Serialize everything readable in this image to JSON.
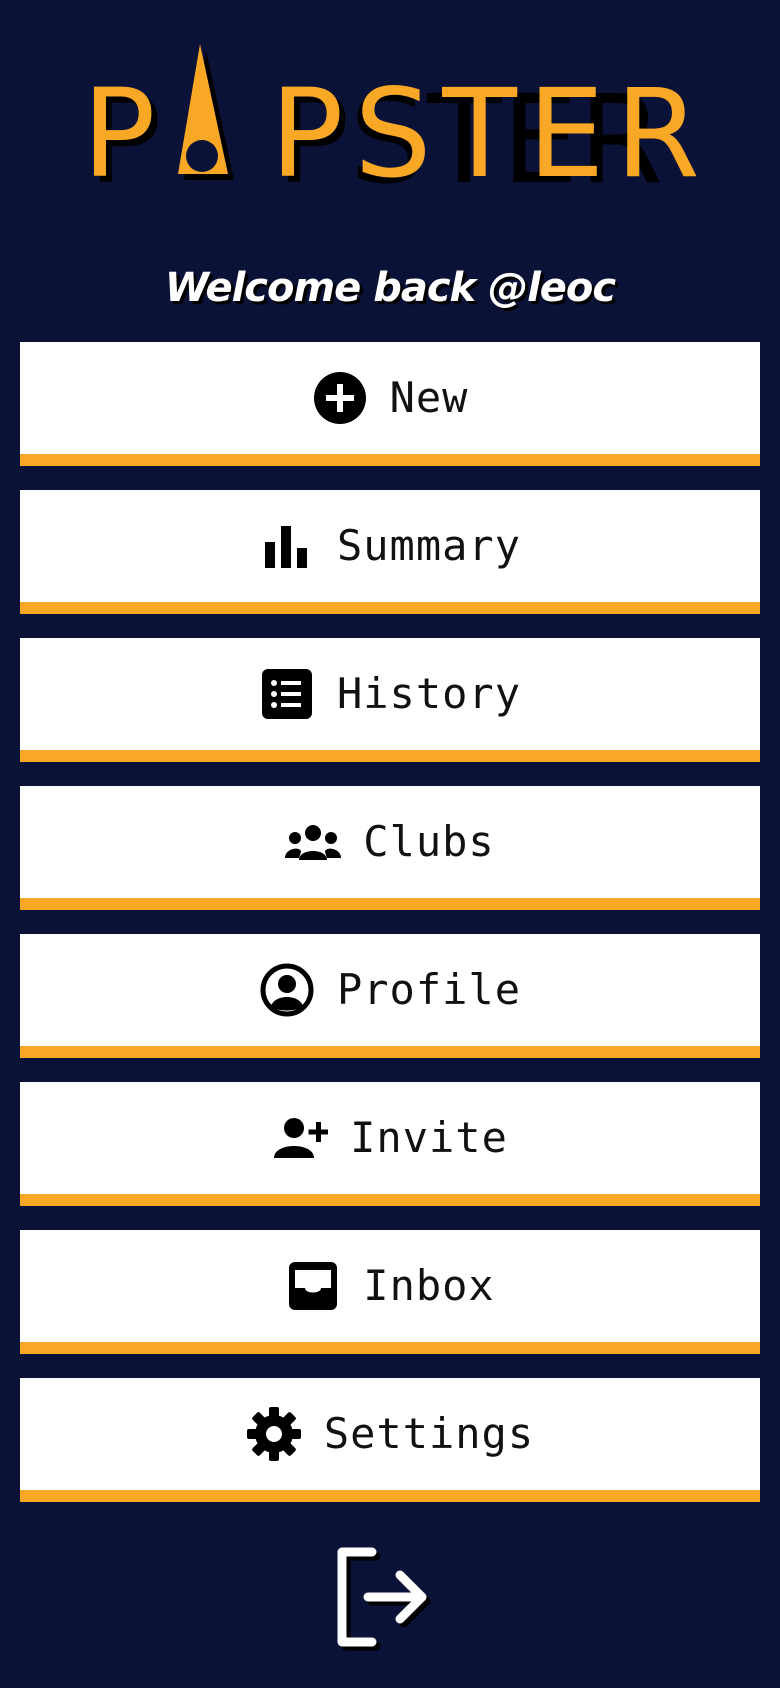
{
  "app": {
    "logo_text": "PAPSTER",
    "brand_color": "#f9a825",
    "background_color": "#0b1238"
  },
  "header": {
    "welcome": "Welcome back @leoc"
  },
  "menu": {
    "items": [
      {
        "label": "New",
        "icon": "plus-circle-icon"
      },
      {
        "label": "Summary",
        "icon": "bar-chart-icon"
      },
      {
        "label": "History",
        "icon": "list-icon"
      },
      {
        "label": "Clubs",
        "icon": "users-group-icon"
      },
      {
        "label": "Profile",
        "icon": "user-circle-icon"
      },
      {
        "label": "Invite",
        "icon": "user-plus-icon"
      },
      {
        "label": "Inbox",
        "icon": "inbox-icon"
      },
      {
        "label": "Settings",
        "icon": "gear-icon"
      }
    ]
  },
  "footer": {
    "logout_icon": "logout-icon"
  }
}
